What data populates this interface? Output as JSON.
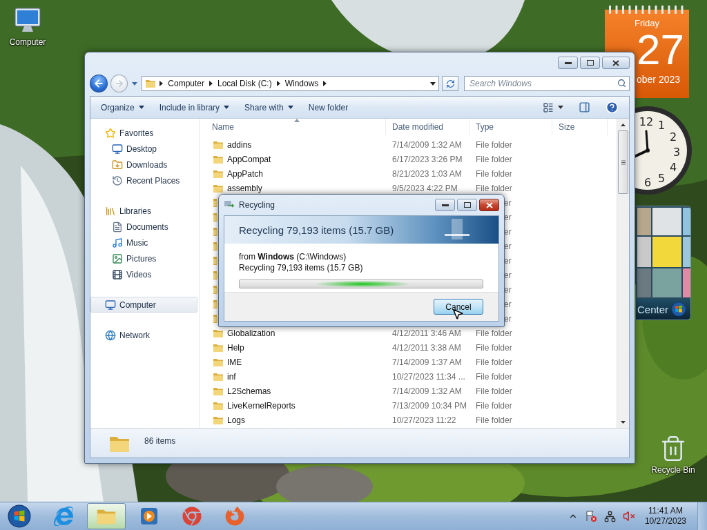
{
  "desktop_icons": [
    {
      "label": "Computer",
      "kind": "computer"
    },
    {
      "label": "Recycle Bin",
      "kind": "recycle"
    }
  ],
  "gadgets": {
    "calendar": {
      "weekday": "Friday",
      "day": "27",
      "month": "ober 2023"
    },
    "clock": {
      "numerals": [
        "12",
        "1",
        "2",
        "3",
        "4",
        "5",
        "6"
      ]
    },
    "media_center": {
      "label": "Center"
    }
  },
  "explorer": {
    "breadcrumb": [
      "Computer",
      "Local Disk (C:)",
      "Windows"
    ],
    "search": {
      "placeholder": "Search Windows"
    },
    "toolbar": [
      {
        "label": "Organize",
        "menu": true
      },
      {
        "label": "Include in library",
        "menu": true
      },
      {
        "label": "Share with",
        "menu": true
      },
      {
        "label": "New folder",
        "menu": false
      }
    ],
    "sidebar": [
      {
        "label": "Favorites",
        "kind": "favorites",
        "selected": false,
        "children": [
          {
            "label": "Desktop",
            "kind": "desktop",
            "selected": false
          },
          {
            "label": "Downloads",
            "kind": "downloads",
            "selected": false
          },
          {
            "label": "Recent Places",
            "kind": "recent",
            "selected": false
          }
        ]
      },
      {
        "label": "Libraries",
        "kind": "libraries",
        "selected": false,
        "children": [
          {
            "label": "Documents",
            "kind": "documents",
            "selected": false
          },
          {
            "label": "Music",
            "kind": "music",
            "selected": false
          },
          {
            "label": "Pictures",
            "kind": "pictures",
            "selected": false
          },
          {
            "label": "Videos",
            "kind": "videos",
            "selected": false
          }
        ]
      },
      {
        "label": "Computer",
        "kind": "computer",
        "selected": true
      },
      {
        "label": "Network",
        "kind": "network",
        "selected": false
      }
    ],
    "columns": [
      "Name",
      "Date modified",
      "Type",
      "Size"
    ],
    "rows": [
      {
        "kind": "folder",
        "name": "addins",
        "date": "7/14/2009 1:32 AM",
        "type": "File folder"
      },
      {
        "kind": "folder",
        "name": "AppCompat",
        "date": "6/17/2023 3:26 PM",
        "type": "File folder"
      },
      {
        "kind": "folder",
        "name": "AppPatch",
        "date": "8/21/2023 1:03 AM",
        "type": "File folder"
      },
      {
        "kind": "folder",
        "name": "assembly",
        "date": "9/5/2023 4:22 PM",
        "type": "File folder"
      },
      {
        "kind": "covered",
        "type": "er"
      },
      {
        "kind": "covered",
        "type": "er"
      },
      {
        "kind": "covered",
        "type": "er"
      },
      {
        "kind": "covered",
        "type": "er"
      },
      {
        "kind": "covered",
        "type": "er"
      },
      {
        "kind": "covered",
        "type": "er"
      },
      {
        "kind": "covered",
        "type": "er"
      },
      {
        "kind": "covered",
        "type": "er"
      },
      {
        "kind": "covered",
        "type": "er"
      },
      {
        "kind": "folder",
        "name": "Globalization",
        "date": "4/12/2011 3:46 AM",
        "type": "File folder"
      },
      {
        "kind": "folder",
        "name": "Help",
        "date": "4/12/2011 3:38 AM",
        "type": "File folder"
      },
      {
        "kind": "folder",
        "name": "IME",
        "date": "7/14/2009 1:37 AM",
        "type": "File folder"
      },
      {
        "kind": "folder",
        "name": "inf",
        "date": "10/27/2023 11:34 ...",
        "type": "File folder"
      },
      {
        "kind": "folder",
        "name": "L2Schemas",
        "date": "7/14/2009 1:32 AM",
        "type": "File folder"
      },
      {
        "kind": "folder",
        "name": "LiveKernelReports",
        "date": "7/13/2009 10:34 PM",
        "type": "File folder"
      },
      {
        "kind": "folder",
        "name": "Logs",
        "date": "10/27/2023 11:22",
        "type": "File folder"
      }
    ],
    "status": "86 items"
  },
  "dialog": {
    "title": "Recycling",
    "heading": "Recycling 79,193 items (15.7 GB)",
    "from": "from **Windows** (C:\\Windows)",
    "detail": "Recycling 79,193 items (15.7 GB)",
    "button": "Cancel",
    "busy": true
  },
  "taskbar": {
    "apps": [
      {
        "kind": "ie",
        "selected": false
      },
      {
        "kind": "explorer",
        "selected": true
      },
      {
        "kind": "media",
        "selected": false
      },
      {
        "kind": "chrome",
        "selected": false
      },
      {
        "kind": "firefox",
        "selected": false
      }
    ],
    "time": "11:41 AM",
    "date": "10/27/2023"
  }
}
